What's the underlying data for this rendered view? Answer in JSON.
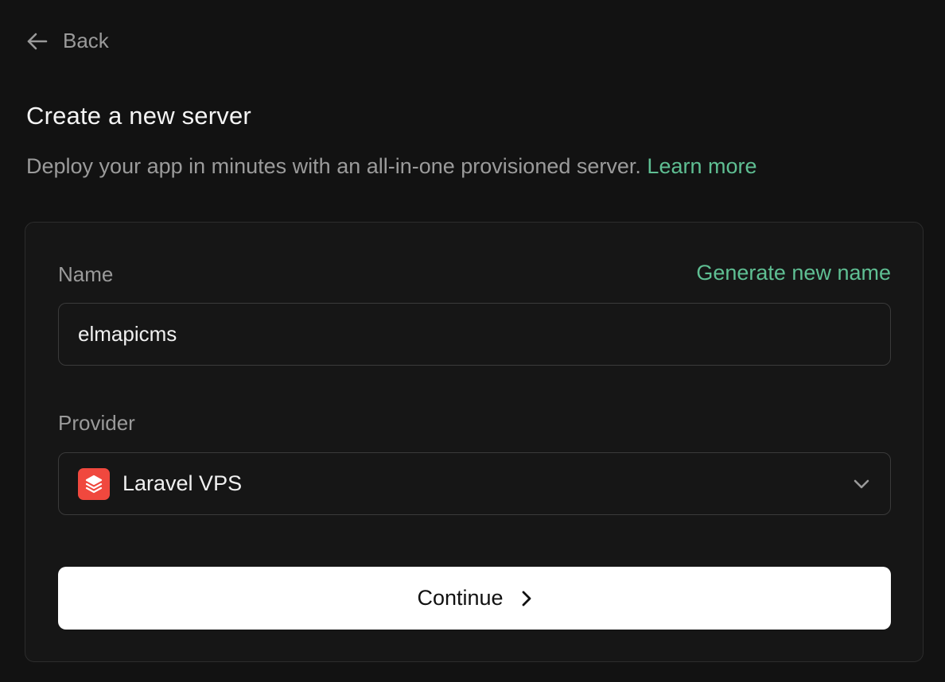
{
  "nav": {
    "back_label": "Back"
  },
  "header": {
    "title": "Create a new server",
    "subtitle": "Deploy your app in minutes with an all-in-one provisioned server.",
    "learn_more": "Learn more"
  },
  "form": {
    "name_label": "Name",
    "generate_label": "Generate new name",
    "name_value": "elmapicms",
    "provider_label": "Provider",
    "provider_value": "Laravel VPS",
    "provider_icon": "laravel-stack-icon",
    "continue_label": "Continue"
  },
  "colors": {
    "background": "#121212",
    "card": "#161616",
    "accent": "#5fbf93",
    "provider_brand": "#f0483e",
    "button": "#ffffff"
  }
}
